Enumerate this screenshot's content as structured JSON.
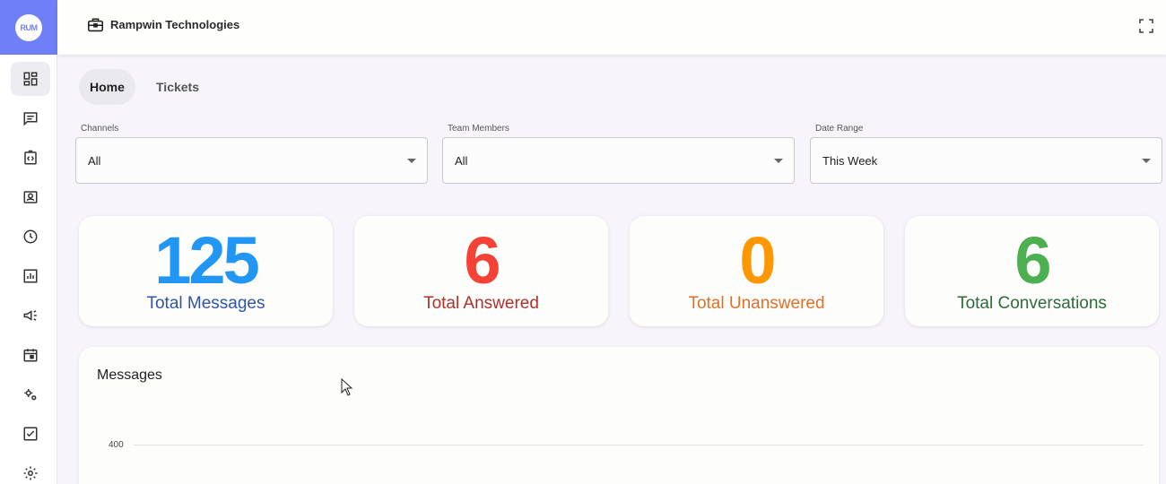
{
  "header": {
    "org_name": "Rampwin Technologies"
  },
  "logo": {
    "text": "RUM"
  },
  "tabs": [
    {
      "label": "Home",
      "active": true
    },
    {
      "label": "Tickets",
      "active": false
    }
  ],
  "filters": [
    {
      "label": "Channels",
      "value": "All"
    },
    {
      "label": "Team Members",
      "value": "All"
    },
    {
      "label": "Date Range",
      "value": "This Week"
    }
  ],
  "stats": [
    {
      "value": "125",
      "label": "Total Messages",
      "value_color": "#2196f3",
      "label_color": "#3054a8"
    },
    {
      "value": "6",
      "label": "Total Answered",
      "value_color": "#f44336",
      "label_color": "#b0302a"
    },
    {
      "value": "0",
      "label": "Total Unanswered",
      "value_color": "#ff9800",
      "label_color": "#e0702a"
    },
    {
      "value": "6",
      "label": "Total Conversations",
      "value_color": "#4caf50",
      "label_color": "#2e6b3a"
    }
  ],
  "chart": {
    "title": "Messages",
    "y_tick": "400"
  },
  "chart_data": {
    "type": "line",
    "title": "Messages",
    "y_ticks": [
      "400"
    ]
  },
  "sidebar": {
    "icons": [
      "dashboard-icon",
      "chat-icon",
      "code-icon",
      "contacts-icon",
      "clock-icon",
      "report-icon",
      "campaign-icon",
      "calendar-icon",
      "automation-icon",
      "tasks-icon",
      "settings-icon"
    ]
  },
  "colors": {
    "accent": "#6f7ff7",
    "background": "#f7f5fb"
  }
}
